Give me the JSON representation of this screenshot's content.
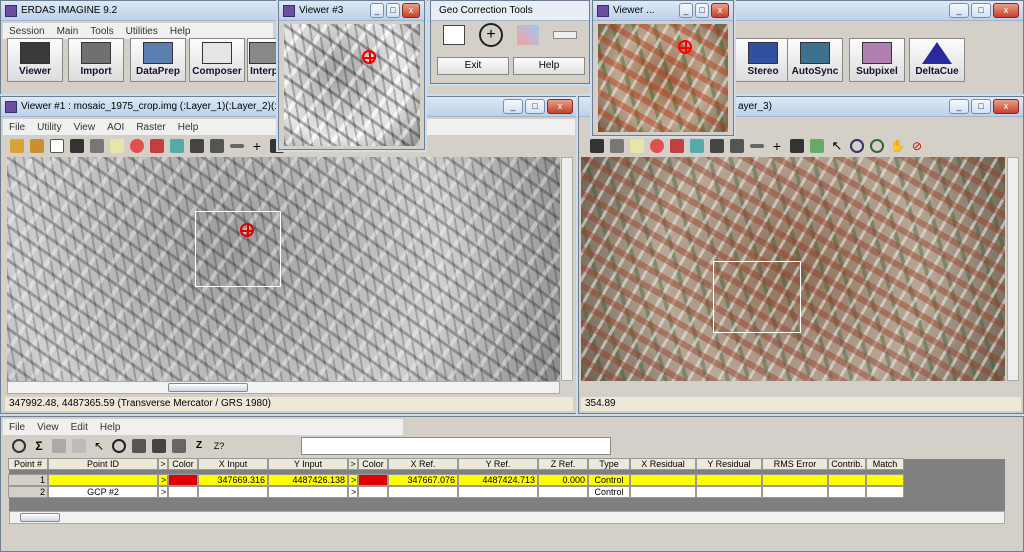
{
  "app": {
    "title": "ERDAS IMAGINE 9.2",
    "menu": [
      "Session",
      "Main",
      "Tools",
      "Utilities",
      "Help"
    ]
  },
  "toolbar_buttons": [
    {
      "label": "Viewer",
      "icon": "viewer-icon"
    },
    {
      "label": "Import",
      "icon": "import-icon"
    },
    {
      "label": "DataPrep",
      "icon": "dataprep-icon"
    },
    {
      "label": "Composer",
      "icon": "composer-icon"
    },
    {
      "label": "Interp",
      "icon": "interpreter-icon"
    },
    {
      "label": "Stereo",
      "icon": "stereo-icon"
    },
    {
      "label": "AutoSync",
      "icon": "autosync-icon"
    },
    {
      "label": "Subpixel",
      "icon": "subpixel-icon"
    },
    {
      "label": "DeltaCue",
      "icon": "deltacue-icon"
    }
  ],
  "viewer3": {
    "title": "Viewer #3"
  },
  "geo_tools": {
    "title": "Geo Correction Tools",
    "exit": "Exit",
    "help": "Help"
  },
  "viewer_small": {
    "title": "Viewer ..."
  },
  "viewer1": {
    "title": "Viewer #1 : mosaic_1975_crop.img (:Layer_1)(:Layer_2)(:Layer_3)",
    "menu": [
      "File",
      "Utility",
      "View",
      "AOI",
      "Raster",
      "Help"
    ],
    "status": "347992.48, 4487365.59  (Transverse Mercator / GRS 1980)"
  },
  "viewer2": {
    "title_suffix": "ayer_3)",
    "status": "354.89"
  },
  "gcp_editor": {
    "menu": [
      "File",
      "View",
      "Edit",
      "Help"
    ],
    "columns": [
      "Point #",
      "Point ID",
      ">",
      "Color",
      "X Input",
      "Y Input",
      ">",
      "Color",
      "X Ref.",
      "Y Ref.",
      "Z Ref.",
      "Type",
      "X Residual",
      "Y Residual",
      "RMS Error",
      "Contrib.",
      "Match"
    ],
    "rows": [
      {
        "num": "1",
        "id": "",
        "arrow1": ">",
        "x_in": "347669.316",
        "y_in": "4487426.138",
        "arrow2": ">",
        "x_ref": "347667.076",
        "y_ref": "4487424.713",
        "z_ref": "0.000",
        "type": "Control",
        "selected": true
      },
      {
        "num": "2",
        "id": "GCP #2",
        "arrow1": ">",
        "x_in": "",
        "y_in": "",
        "arrow2": ">",
        "x_ref": "",
        "y_ref": "",
        "z_ref": "",
        "type": "Control",
        "selected": false
      }
    ]
  },
  "colors": {
    "selected_row": "#ffff00",
    "gcp_color": "#e00000",
    "title_bg": "#bcd1ea"
  }
}
